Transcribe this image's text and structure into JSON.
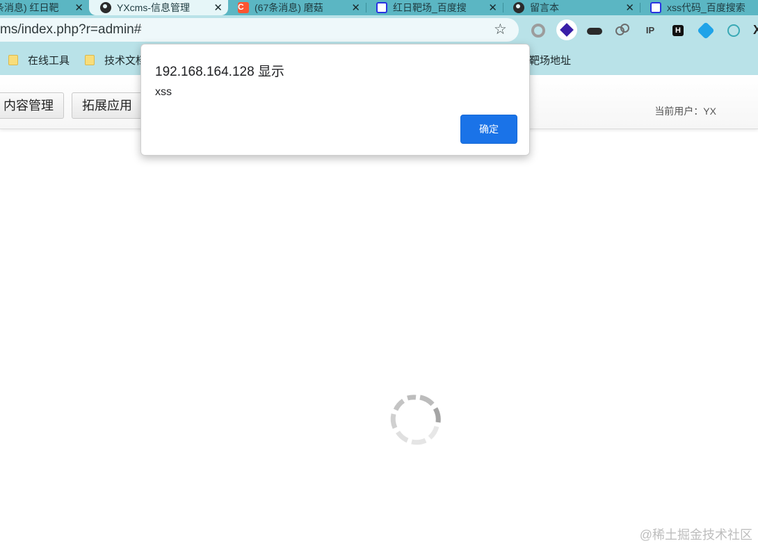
{
  "tabs": [
    {
      "title": "条消息) 红日靶",
      "icon": "baidu-icon",
      "active": false
    },
    {
      "title": "YXcms-信息管理",
      "icon": "globe-icon",
      "active": true
    },
    {
      "title": "(67条消息) 磨菇",
      "icon": "csdn-icon",
      "active": false
    },
    {
      "title": "红日靶场_百度搜",
      "icon": "baidu-icon",
      "active": false
    },
    {
      "title": "留言本",
      "icon": "globe-icon",
      "active": false
    },
    {
      "title": "xss代码_百度搜索",
      "icon": "baidu-icon",
      "active": false
    }
  ],
  "tab_close_glyph": "✕",
  "address": {
    "url": "ms/index.php?r=admin#"
  },
  "toolbar": {
    "star_glyph": "☆",
    "extensions": [
      "ring-extension-icon",
      "layers-extension-icon",
      "mask-extension-icon",
      "bubbles-extension-icon",
      "ip-extension-icon",
      "h-extension-icon",
      "cube-extension-icon",
      "globe-extension-icon",
      "x-extension-icon"
    ],
    "ip_label": "IP",
    "h_label": "H",
    "x_label": "X"
  },
  "bookmarks": [
    {
      "label": "在线工具"
    },
    {
      "label": "技术文档"
    },
    {
      "label": "靶场地址"
    }
  ],
  "page": {
    "nav_buttons": [
      "内容管理",
      "拓展应用"
    ],
    "current_user": "当前用户：YX"
  },
  "dialog": {
    "title": "192.168.164.128 显示",
    "message": "xss",
    "ok_label": "确定"
  },
  "watermark": "@稀土掘金技术社区",
  "colors": {
    "tab_strip": "#5bb6c3",
    "toolbar": "#b9e2e8",
    "primary_button": "#1a73e8"
  }
}
